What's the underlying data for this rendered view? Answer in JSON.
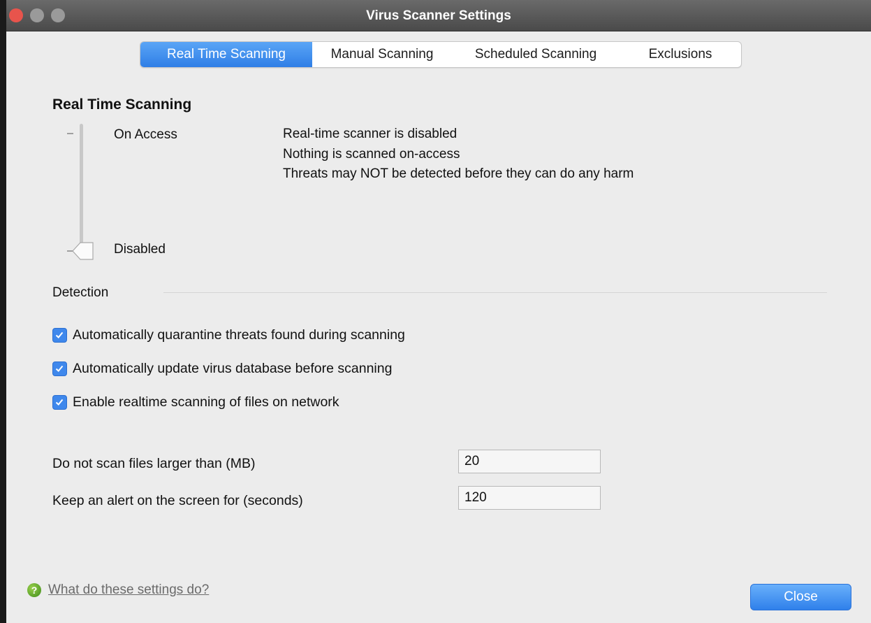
{
  "window": {
    "title": "Virus Scanner Settings"
  },
  "tabs": [
    {
      "label": "Real Time Scanning",
      "active": true
    },
    {
      "label": "Manual Scanning",
      "active": false
    },
    {
      "label": "Scheduled Scanning",
      "active": false
    },
    {
      "label": "Exclusions",
      "active": false
    }
  ],
  "real_time": {
    "heading": "Real Time Scanning",
    "levels": {
      "top": "On Access",
      "bottom": "Disabled"
    },
    "selected_level": "Disabled",
    "description": [
      "Real-time scanner is disabled",
      "Nothing is scanned on-access",
      "Threats may NOT be detected before they can do any harm"
    ]
  },
  "detection": {
    "label": "Detection",
    "checkboxes": [
      {
        "label": "Automatically quarantine threats found during scanning",
        "checked": true
      },
      {
        "label": "Automatically update virus database before scanning",
        "checked": true
      },
      {
        "label": "Enable realtime scanning of files on network",
        "checked": true
      }
    ]
  },
  "fields": [
    {
      "label": "Do not scan files larger than (MB)",
      "value": "20"
    },
    {
      "label": "Keep an alert on the screen for (seconds)",
      "value": "120"
    }
  ],
  "footer": {
    "help_link": "What do these settings do?",
    "close_label": "Close"
  },
  "colors": {
    "accent": "#3f88ec",
    "close_traffic": "#e8544c",
    "help_icon": "#5aa52a"
  }
}
